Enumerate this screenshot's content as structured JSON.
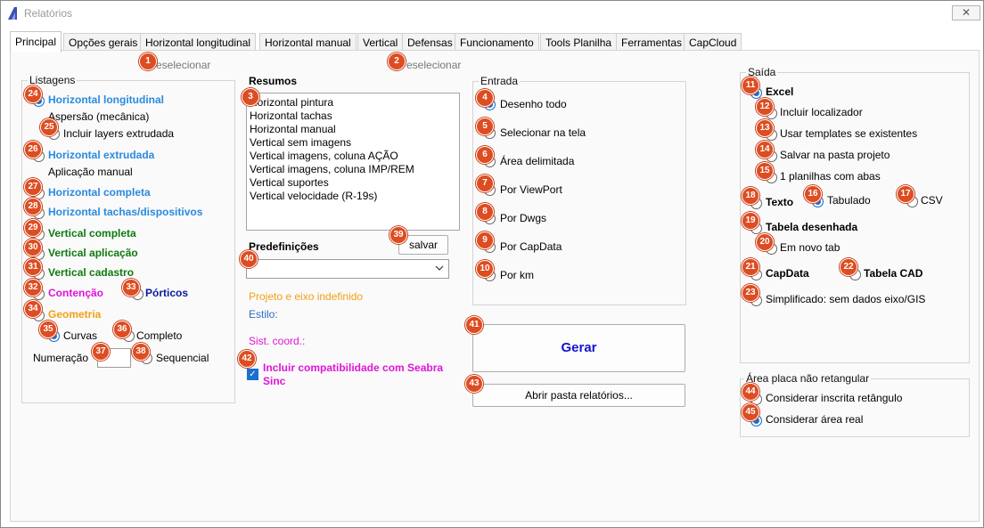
{
  "window": {
    "title": "Relatórios",
    "close_glyph": "✕",
    "logo_icon": "report-app-icon"
  },
  "tabs": [
    {
      "label": "Principal",
      "active": true
    },
    {
      "label": "Opções gerais"
    },
    {
      "label": "Horizontal longitudinal"
    },
    {
      "label": "Horizontal manual"
    },
    {
      "label": "Vertical"
    },
    {
      "label": "Defensas"
    },
    {
      "label": "Funcionamento"
    },
    {
      "label": "Tools Planilha"
    },
    {
      "label": "Ferramentas"
    },
    {
      "label": "CapCloud"
    }
  ],
  "deselect_links": [
    "eselecionar",
    "eselecionar"
  ],
  "listagens": {
    "title": "Listagens",
    "items": {
      "horizontal_longitudinal": "Horizontal longitudinal",
      "aspersao": "Aspersão (mecânica)",
      "incluir_layers": "Incluir layers extrudada",
      "horizontal_extrudada": "Horizontal extrudada",
      "aplicacao_manual": "Aplicação manual",
      "horizontal_completa": "Horizontal completa",
      "horizontal_tachas": "Horizontal tachas/dispositivos",
      "vertical_completa": "Vertical completa",
      "vertical_aplicacao": "Vertical aplicação",
      "vertical_cadastro": "Vertical cadastro",
      "contencao": "Contenção",
      "porticos": "Pórticos",
      "geometria": "Geometria",
      "curvas": "Curvas",
      "completo": "Completo",
      "numeracao": "Numeração",
      "sequencial": "Sequencial"
    }
  },
  "resumos": {
    "title": "Resumos",
    "items": [
      "Horizontal pintura",
      "Horizontal tachas",
      "Horizontal manual",
      "Vertical sem imagens",
      "Vertical imagens, coluna AÇÃO",
      "Vertical imagens, coluna IMP/REM",
      "Vertical suportes",
      "Vertical velocidade (R-19s)"
    ]
  },
  "predefinicoes": {
    "label": "Predefinições",
    "save_label": "salvar",
    "selected": "",
    "chevron_icon": "chevron-down-icon"
  },
  "info": {
    "projeto": "Projeto e eixo indefinido",
    "estilo": "Estilo:",
    "sist_coord": "Sist. coord.:",
    "incluir_compat": "Incluir compatibilidade com Seabra Sinc"
  },
  "entrada": {
    "title": "Entrada",
    "items": [
      "Desenho todo",
      "Selecionar na tela",
      "Área delimitada",
      "Por ViewPort",
      "Por Dwgs",
      "Por CapData",
      "Por km"
    ],
    "selected": 0
  },
  "actions": {
    "gerar": "Gerar",
    "abrir_pasta": "Abrir pasta relatórios..."
  },
  "saida": {
    "title": "Saída",
    "excel": "Excel",
    "incluir_localizador": "Incluir localizador",
    "usar_templates": "Usar templates se existentes",
    "salvar_pasta": "Salvar na pasta projeto",
    "planilhas_abas": "1 planilhas com abas",
    "texto": "Texto",
    "tabulado": "Tabulado",
    "csv": "CSV",
    "tabela_desenhada": "Tabela desenhada",
    "novo_tab": "Em novo tab",
    "capdata": "CapData",
    "tabela_cad": "Tabela CAD",
    "simplificado": "Simplificado: sem dados eixo/GIS"
  },
  "area_placa": {
    "title": "Área placa não retangular",
    "inscrita": "Considerar inscrita retângulo",
    "real": "Considerar área real"
  },
  "badges": [
    "1",
    "2",
    "3",
    "4",
    "5",
    "6",
    "7",
    "8",
    "9",
    "10",
    "11",
    "12",
    "13",
    "14",
    "15",
    "16",
    "17",
    "18",
    "19",
    "20",
    "21",
    "22",
    "23",
    "24",
    "25",
    "26",
    "27",
    "28",
    "29",
    "30",
    "31",
    "32",
    "33",
    "34",
    "35",
    "36",
    "37",
    "38",
    "39",
    "40",
    "41",
    "42",
    "43",
    "44",
    "45"
  ],
  "colors": {
    "accent_blue": "#2a8ae0",
    "green": "#0f7a0f",
    "magenta": "#e015d8",
    "orange": "#f0a016",
    "navy": "#0a1aa0",
    "badge": "#dd4d22",
    "gerar": "#1414c8"
  }
}
